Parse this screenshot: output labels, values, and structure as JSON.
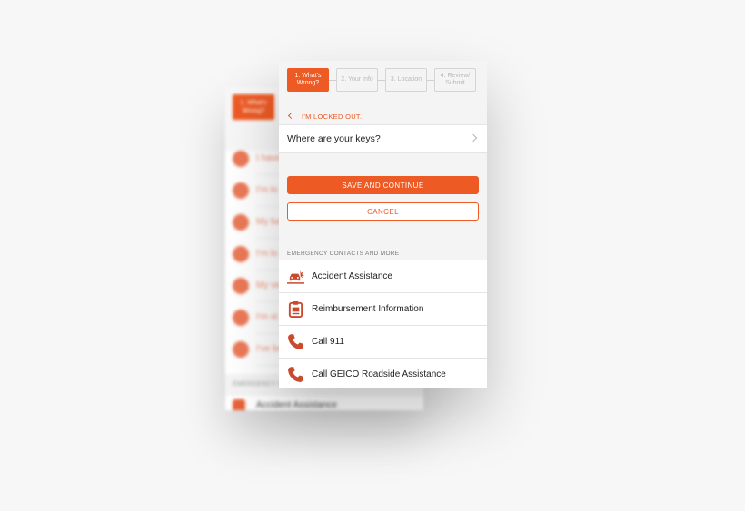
{
  "background_screen": {
    "step_label": "1. What's Wrong?",
    "items": [
      {
        "label": "I have",
        "icon": "tire-icon"
      },
      {
        "label": "I'm lo",
        "icon": "lock-icon"
      },
      {
        "label": "My ba",
        "icon": "battery-icon"
      },
      {
        "label": "I'm lo",
        "icon": "key-icon"
      },
      {
        "label": "My ve",
        "icon": "tow-icon"
      },
      {
        "label": "I'm st",
        "icon": "stuck-car-icon"
      },
      {
        "label": "I've be",
        "icon": "accident-car-icon"
      }
    ],
    "section_label": "EMERGENCY C",
    "section_row": "Accident Assistance"
  },
  "steps": [
    {
      "label": "1. What's Wrong?",
      "state": "active"
    },
    {
      "label": "2. Your Info",
      "state": "inactive"
    },
    {
      "label": "3. Location",
      "state": "inactive"
    },
    {
      "label": "4. Review/ Submit",
      "state": "inactive"
    }
  ],
  "breadcrumb": {
    "text": "I'M LOCKED OUT."
  },
  "question": {
    "text": "Where are your keys?"
  },
  "buttons": {
    "save": "SAVE AND CONTINUE",
    "cancel": "CANCEL"
  },
  "section_label": "EMERGENCY CONTACTS AND MORE",
  "contacts": [
    {
      "label": "Accident Assistance",
      "icon": "car-crash-icon"
    },
    {
      "label": "Reimbursement Information",
      "icon": "clipboard-icon"
    },
    {
      "label": "Call 911",
      "icon": "phone-icon"
    },
    {
      "label": "Call GEICO Roadside Assistance",
      "icon": "phone-icon"
    }
  ],
  "colors": {
    "accent": "#ee5a24",
    "icon": "#c94a2c"
  }
}
